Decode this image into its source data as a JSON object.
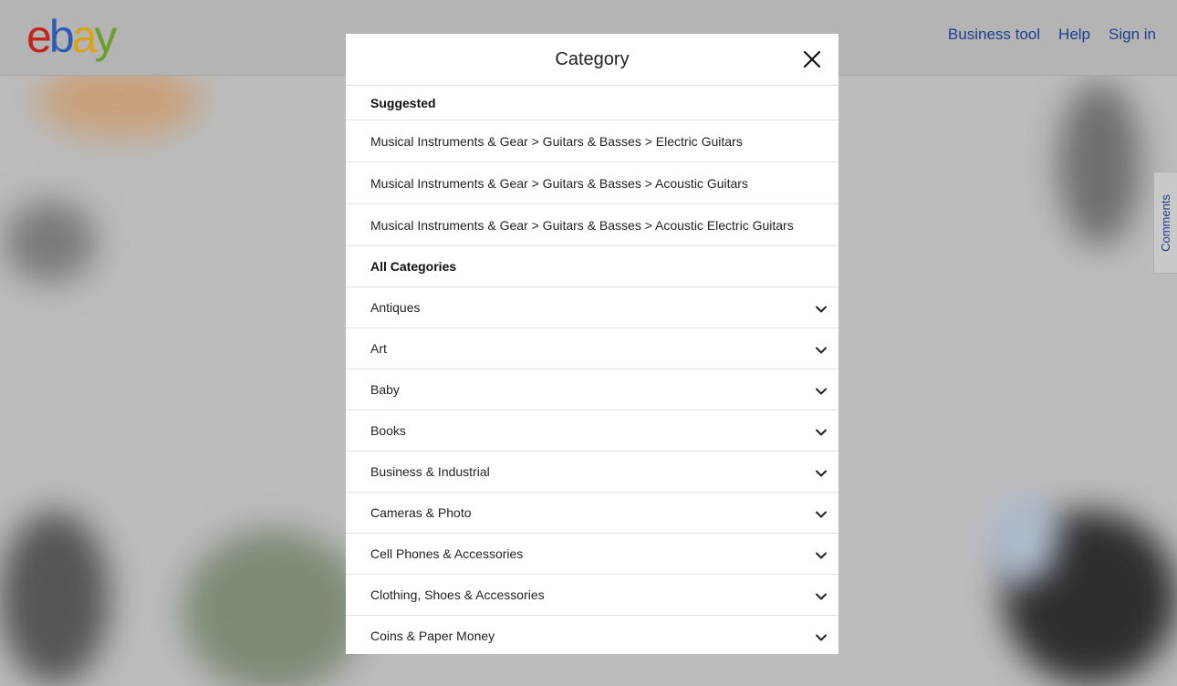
{
  "header": {
    "logo_letters": [
      "e",
      "b",
      "a",
      "y"
    ],
    "nav": [
      "Business tool",
      "Help",
      "Sign in"
    ]
  },
  "comments_tab": "Comments",
  "modal": {
    "title": "Category",
    "suggested_heading": "Suggested",
    "suggested": [
      "Musical Instruments & Gear > Guitars & Basses > Electric Guitars",
      "Musical Instruments & Gear > Guitars & Basses > Acoustic Guitars",
      "Musical Instruments & Gear > Guitars & Basses > Acoustic Electric Guitars"
    ],
    "all_heading": "All Categories",
    "categories": [
      "Antiques",
      "Art",
      "Baby",
      "Books",
      "Business & Industrial",
      "Cameras & Photo",
      "Cell Phones & Accessories",
      "Clothing, Shoes & Accessories",
      "Coins & Paper Money"
    ]
  },
  "colors": {
    "logo_e": "#c4241e",
    "logo_b": "#2a5cb8",
    "logo_a": "#d9a418",
    "logo_y": "#6c9e2a",
    "link": "#1f3d8e",
    "overlay_bg": "#bcbcbc"
  },
  "icons": {
    "close": "close-icon",
    "expand": "chevron-down-icon"
  }
}
